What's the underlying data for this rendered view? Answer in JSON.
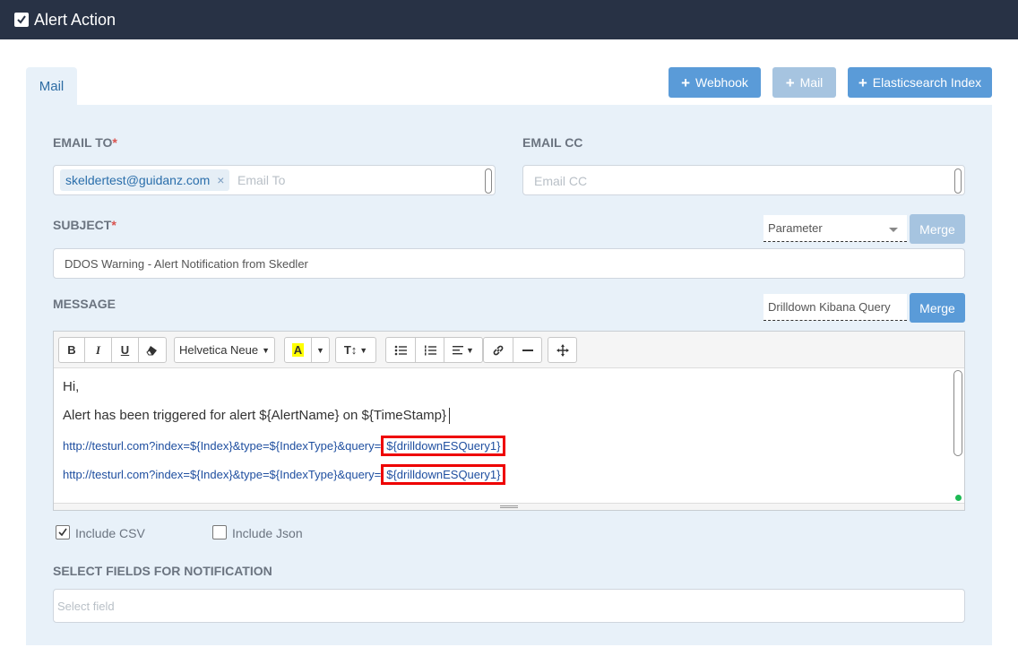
{
  "header": {
    "title": "Alert Action",
    "checked": true
  },
  "tabs": [
    {
      "label": "Mail",
      "active": true
    }
  ],
  "actions": {
    "webhook_label": "Webhook",
    "mail_label": "Mail",
    "es_index_label": "Elasticsearch Index"
  },
  "email_to": {
    "label": "EMAIL TO",
    "required_mark": "*",
    "tags": [
      "skeldertest@guidanz.com"
    ],
    "tag_remove": "×",
    "placeholder": "Email To"
  },
  "email_cc": {
    "label": "EMAIL CC",
    "placeholder": "Email CC"
  },
  "subject": {
    "label": "SUBJECT",
    "required_mark": "*",
    "parameter_select": "Parameter",
    "merge_label": "Merge",
    "value": "DDOS Warning - Alert Notification from Skedler"
  },
  "message": {
    "label": "MESSAGE",
    "drilldown_select": "Drilldown Kibana Query",
    "merge_label": "Merge",
    "toolbar": {
      "bold": "B",
      "italic": "I",
      "underline": "U",
      "font": "Helvetica Neue",
      "highlight": "A",
      "font_size": "T↕"
    },
    "body": {
      "greeting": "Hi,",
      "line": "Alert has been triggered for alert ${AlertName} on ${TimeStamp}",
      "url_prefix": "http://testurl.com?index=${Index}&type=${IndexType}&query=",
      "url_param": "${drilldownESQuery1}"
    }
  },
  "options": {
    "include_csv": {
      "label": "Include CSV",
      "checked": true
    },
    "include_json": {
      "label": "Include Json",
      "checked": false
    }
  },
  "notification_fields": {
    "label": "SELECT FIELDS FOR NOTIFICATION",
    "placeholder": "Select field"
  },
  "colors": {
    "topbar": "#283245",
    "accent": "#5a9bd8",
    "highlight_border": "#e00000"
  }
}
